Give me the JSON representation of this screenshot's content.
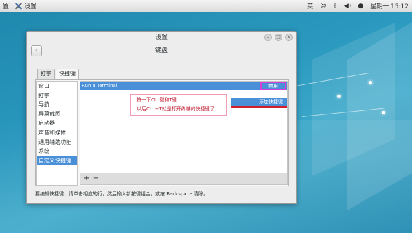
{
  "topbar": {
    "apps_label": "置",
    "settings_label": "设置",
    "input_method": "英",
    "clock": "星期一 15:12"
  },
  "window": {
    "title": "设置",
    "header_title": "键盘",
    "tabs": [
      {
        "label": "打字",
        "active": false
      },
      {
        "label": "快捷键",
        "active": true
      }
    ],
    "categories": [
      {
        "label": "窗口",
        "selected": false
      },
      {
        "label": "打字",
        "selected": false
      },
      {
        "label": "导航",
        "selected": false
      },
      {
        "label": "屏幕截图",
        "selected": false
      },
      {
        "label": "启动器",
        "selected": false
      },
      {
        "label": "声音和媒体",
        "selected": false
      },
      {
        "label": "通用辅助功能",
        "selected": false
      },
      {
        "label": "系统",
        "selected": false
      },
      {
        "label": "自定义快捷键",
        "selected": true
      }
    ],
    "shortcuts": [
      {
        "name": "Run a Terminal",
        "accel": "禁用"
      }
    ],
    "add_button_label": "添加快捷键",
    "annotation_lines": [
      "按一下Ctrl键和T键",
      "以后Ctrl+T就是打开终端的快捷键了"
    ],
    "toolbar": {
      "add": "+",
      "remove": "−"
    },
    "footer": "要编辑快捷键，请单击相应的行，然后输入新按键组合，或按 Backspace 清除。"
  },
  "colors": {
    "accent": "#4a90d9",
    "highlight_box": "#d63ed6",
    "annotation_text": "#c0182e",
    "underline": "#d11f2a",
    "desktop": "#2a98be"
  }
}
